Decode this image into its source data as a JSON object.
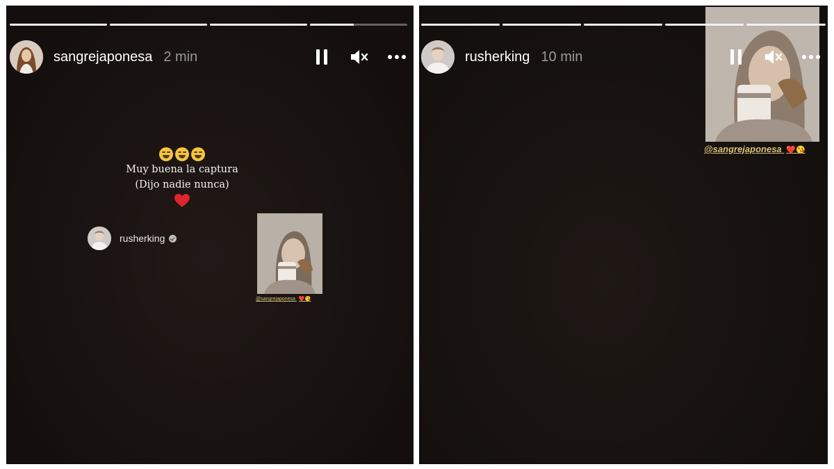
{
  "stories": [
    {
      "username": "sangrejaponesa",
      "time": "2 min",
      "progress": [
        1,
        1,
        1,
        0.45
      ],
      "caption": {
        "emojis": [
          "grinning-sweat-face",
          "grinning-sweat-face",
          "grinning-sweat-face"
        ],
        "line1": "Muy buena la captura",
        "line2": "(Dijo nadie nunca)",
        "heart": "❤️"
      },
      "repost": {
        "username": "rusherking",
        "verified": true,
        "mention": "@sangrejaponesa",
        "mention_emojis": "❤️😘"
      }
    },
    {
      "username": "rusherking",
      "time": "10 min",
      "progress": [
        1,
        1,
        1,
        1
      ],
      "mention": "@sangrejaponesa",
      "mention_emojis": "❤️😘"
    }
  ],
  "colors": {
    "background": "#1a1412",
    "mention": "#d9c37a",
    "heart": "#e0242d"
  },
  "icons": [
    "pause-icon",
    "mute-icon",
    "more-icon"
  ]
}
